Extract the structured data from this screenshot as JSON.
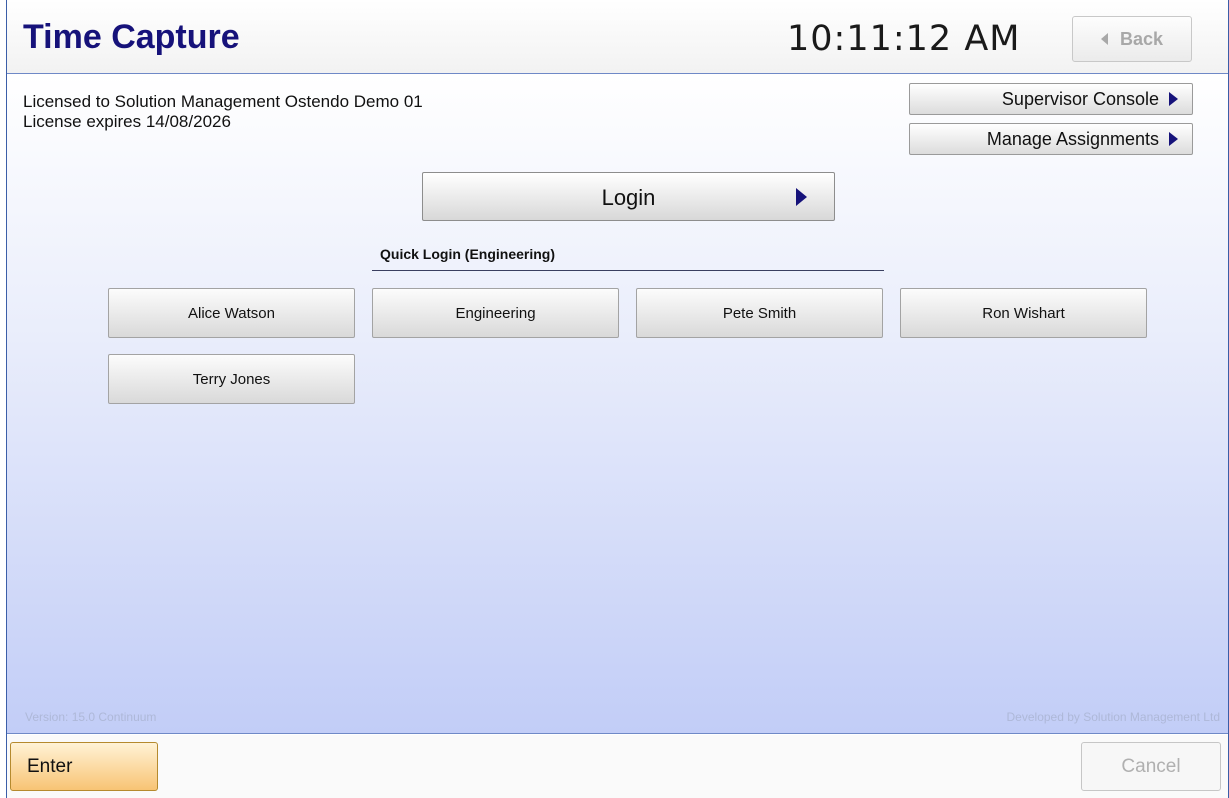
{
  "header": {
    "title": "Time Capture",
    "clock": "10:11:12 AM",
    "back_label": "Back"
  },
  "license": {
    "line1": "Licensed to Solution Management Ostendo Demo 01",
    "line2": "License expires 14/08/2026"
  },
  "side_buttons": {
    "supervisor_label": "Supervisor Console",
    "assignments_label": "Manage Assignments"
  },
  "login": {
    "label": "Login"
  },
  "quick_login": {
    "title": "Quick Login (Engineering)",
    "items": [
      "Alice Watson",
      "Engineering",
      "Pete Smith",
      "Ron Wishart",
      "Terry Jones"
    ]
  },
  "footer_info": {
    "version": "Version: 15.0 Continuum",
    "developer": "Developed by Solution Management Ltd"
  },
  "footer": {
    "enter_label": "Enter",
    "cancel_label": "Cancel"
  },
  "colors": {
    "title": "#16127a",
    "accent_arrow": "#16127a",
    "enter_button": "#f8c474",
    "body_gradient_end": "#c2cdf7"
  }
}
